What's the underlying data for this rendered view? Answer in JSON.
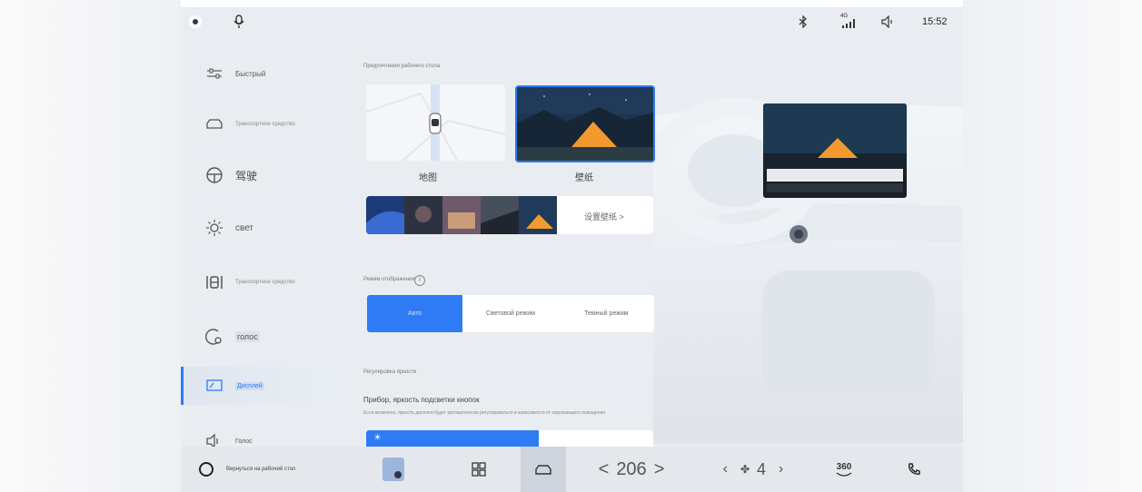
{
  "status_bar": {
    "time": "15:52",
    "left_icons": [
      "status-dot-icon",
      "microphone-icon"
    ],
    "right_icons": [
      "bluetooth-icon",
      "signal-icon",
      "volume-icon"
    ],
    "signal_label": "4G"
  },
  "sidebar": {
    "items": [
      {
        "label": "Быстрый",
        "icon": "sliders-icon"
      },
      {
        "label": "Транспортное средство",
        "icon": "car-icon"
      },
      {
        "label": "驾驶",
        "icon": "steering-wheel-icon"
      },
      {
        "label": "свет",
        "icon": "light-icon"
      },
      {
        "label": "Транспортное средство",
        "icon": "seat-icon"
      },
      {
        "label": "голос",
        "icon": "voice-icon"
      },
      {
        "label": "Дисплей",
        "icon": "display-icon",
        "active": true
      },
      {
        "label": "Голос",
        "icon": "volume-icon"
      }
    ]
  },
  "main": {
    "desktop_section_title": "Предпочтения рабочего стола",
    "desktop_options": [
      {
        "label": "地图",
        "selected": false
      },
      {
        "label": "壁纸",
        "selected": true
      }
    ],
    "wallpaper_link": "设置壁纸 >",
    "display_mode_title": "Режим отображения",
    "display_modes": [
      {
        "label": "Авто",
        "selected": true
      },
      {
        "label": "Световой режим",
        "selected": false
      },
      {
        "label": "Темный режим",
        "selected": false
      }
    ],
    "brightness_section_title": "Регулировка яркости",
    "brightness_label": "Прибор, яркость подсветки кнопок",
    "brightness_hint": "Если включено, яркость дисплея будет автоматически регулироваться в зависимости от окружающего освещения",
    "brightness_level": 0.6
  },
  "bottom_bar": {
    "home_label": "Вернуться на рабочий стол",
    "temperature_value": "206",
    "fan_level": "4",
    "camera_label": "360"
  },
  "colors": {
    "accent": "#2f7bf3",
    "screen_bg": "#e9edf1"
  }
}
